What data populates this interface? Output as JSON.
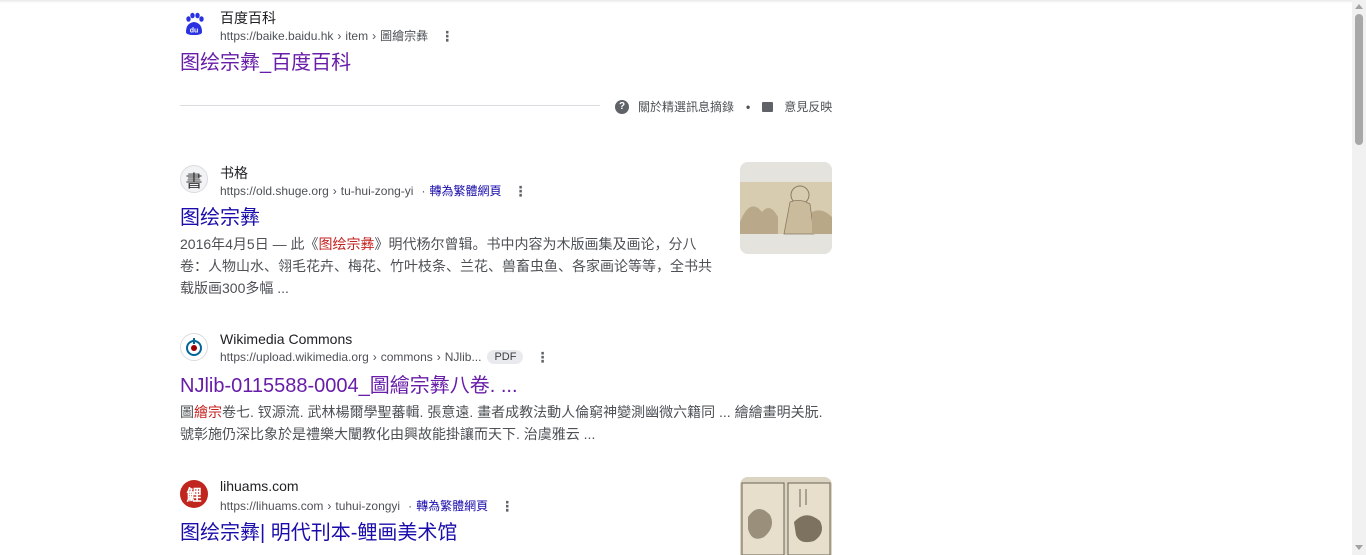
{
  "results": [
    {
      "site": "百度百科",
      "url_base": "https://baike.baidu.hk",
      "path": [
        "item",
        "圖繪宗彝"
      ],
      "title": "图绘宗彝_百度百科",
      "favicon": "baidu-paw-icon"
    },
    {
      "site": "书格",
      "url_base": "https://old.shuge.org",
      "path": [
        "tu-hui-zong-yi"
      ],
      "translate": "轉為繁體網頁",
      "title": "图绘宗彝",
      "snippet": {
        "before": "2016年4月5日 — 此《",
        "highlight": "图绘宗彝",
        "after": "》明代杨尔曾辑。书中内容为木版画集及画论，分八卷：人物山水、翎毛花卉、梅花、竹叶枝条、兰花、兽畜虫鱼、各家画论等等，全书共载版画300多幅 ..."
      },
      "favicon_char": "書"
    },
    {
      "site": "Wikimedia Commons",
      "url_base": "https://upload.wikimedia.org",
      "path": [
        "commons",
        "NJlib..."
      ],
      "badge": "PDF",
      "title": "NJlib-0115588-0004_圖繪宗彝八卷. ...",
      "snippet": {
        "before": "圖",
        "highlight": "繪宗",
        "after": "卷七. 钗源流. 武林楊爾學聖蕃輯. 張意遠. 畫者成教法動人倫窮神變測幽微六籍同 ... 繪繪畫明关朊. 號彰施仍深比象於是禮樂大闡教化由興故能掛讓而天下. 治虞雅云 ..."
      },
      "favicon": "wikimedia-icon"
    },
    {
      "site": "lihuams.com",
      "url_base": "https://lihuams.com",
      "path": [
        "tuhui-zongyi"
      ],
      "translate": "轉為繁體網頁",
      "title": "图绘宗彝| 明代刊本-鲤画美术馆",
      "favicon_char": "鯉"
    }
  ],
  "featured_feedback": {
    "about": "關於精選訊息摘錄",
    "separator": "•",
    "feedback": "意見反映"
  },
  "colors": {
    "visited_link": "#681da8",
    "link": "#1a0dab",
    "highlight": "#c5221f",
    "baidu_blue": "#2932e1",
    "lihua_red": "#c0261e"
  }
}
